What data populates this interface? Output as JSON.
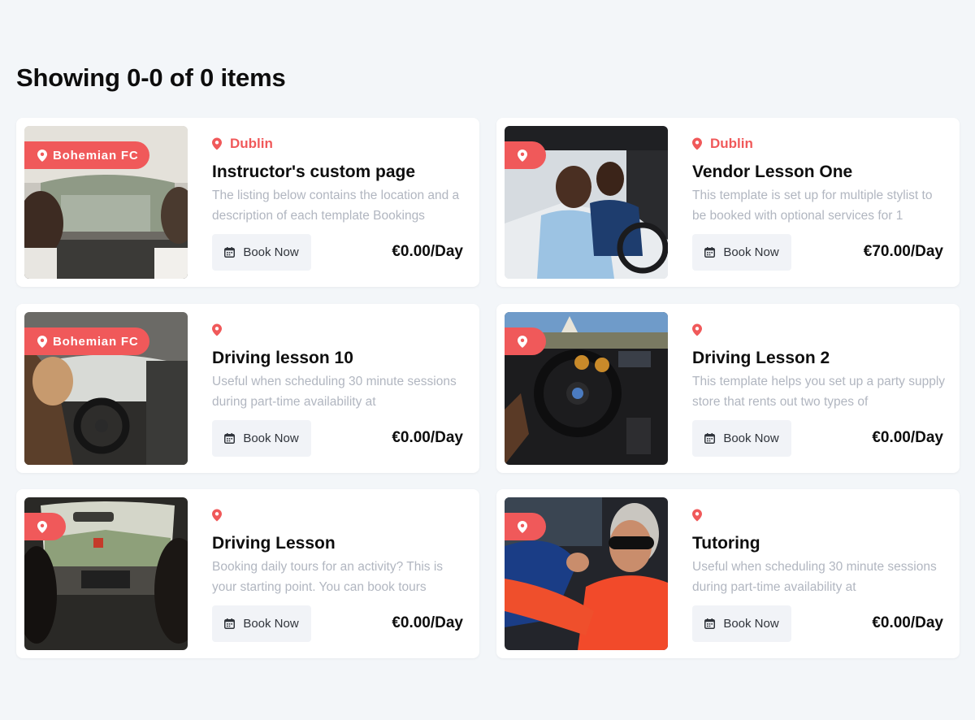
{
  "heading": "Showing 0-0 of 0 items",
  "colors": {
    "accent": "#f0595a",
    "background": "#f3f6f9"
  },
  "cards": [
    {
      "badge": "Bohemian FC",
      "city": "Dublin",
      "title": "Instructor's custom page",
      "description": "The listing below contains the location and a description of each template Bookings",
      "button": "Book Now",
      "price": "€0.00/Day"
    },
    {
      "badge": "",
      "city": "Dublin",
      "title": "Vendor Lesson One",
      "description": "This template is set up for multiple stylist to be booked with optional services for 1",
      "button": "Book Now",
      "price": "€70.00/Day"
    },
    {
      "badge": "Bohemian FC",
      "city": "",
      "title": "Driving lesson 10",
      "description": "Useful when scheduling 30 minute sessions during part-time availability at",
      "button": "Book Now",
      "price": "€0.00/Day"
    },
    {
      "badge": "",
      "city": "",
      "title": "Driving Lesson 2",
      "description": "This template helps you set up a party supply store that rents out two types of",
      "button": "Book Now",
      "price": "€0.00/Day"
    },
    {
      "badge": "",
      "city": "",
      "title": "Driving Lesson",
      "description": "Booking daily tours for an activity? This is your starting point. You can book tours",
      "button": "Book Now",
      "price": "€0.00/Day"
    },
    {
      "badge": "",
      "city": "",
      "title": "Tutoring",
      "description": "Useful when scheduling 30 minute sessions during part-time availability at",
      "button": "Book Now",
      "price": "€0.00/Day"
    }
  ]
}
